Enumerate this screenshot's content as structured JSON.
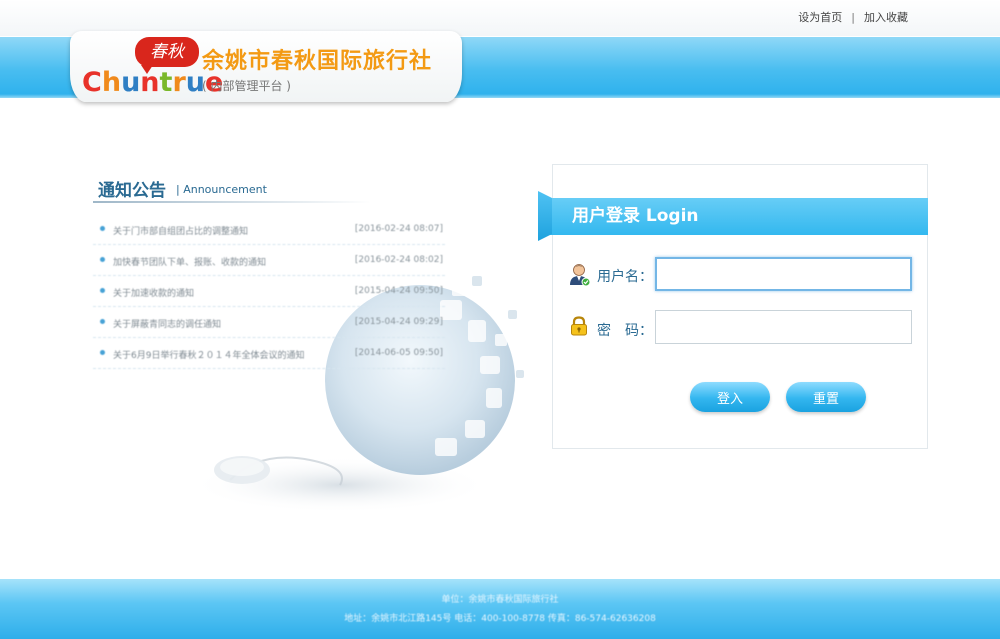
{
  "top_links": {
    "set_homepage": "设为首页",
    "separator": "|",
    "add_favorite": "加入收藏"
  },
  "header": {
    "logo_chinese": "春秋",
    "logo_letters": [
      "C",
      "h",
      "u",
      "n",
      "t",
      "r",
      "u",
      "e"
    ],
    "company_name": "余姚市春秋国际旅行社",
    "platform_subtitle": "( 内部管理平台 )"
  },
  "notice": {
    "title": "通知公告",
    "subtitle": "| Announcement",
    "items": [
      {
        "text": "关于门市部自组团占比的调整通知",
        "date": "[2016-02-24 08:07]"
      },
      {
        "text": "加快春节团队下单、报账、收款的通知",
        "date": "[2016-02-24 08:02]"
      },
      {
        "text": "关于加速收款的通知",
        "date": "[2015-04-24 09:50]"
      },
      {
        "text": "关于屏蔽青同志的调任通知",
        "date": "[2015-04-24 09:29]"
      },
      {
        "text": "关于6月9日举行春秋２０１４年全体会议的通知",
        "date": "[2014-06-05 09:50]"
      }
    ]
  },
  "login": {
    "title": "用户登录 Login",
    "username_label": "用户名：",
    "password_label": "密　码：",
    "username_value": "",
    "password_value": "",
    "login_button": "登入",
    "reset_button": "重置"
  },
  "footer": {
    "line1": "单位：余姚市春秋国际旅行社",
    "line2": "地址：余姚市北江路145号 电话：400-100-8778 传真：86-574-62636208"
  },
  "colors": {
    "accent_blue": "#33b6ef",
    "brand_orange": "#f39a14",
    "logo_red": "#d9261c",
    "label_blue": "#2a6a92"
  }
}
